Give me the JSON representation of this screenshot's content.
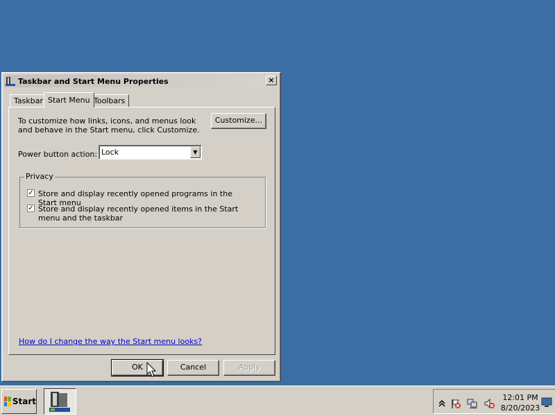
{
  "dialog": {
    "title": "Taskbar and Start Menu Properties",
    "close_label": "×",
    "tabs": [
      {
        "label": "Taskbar",
        "active": false
      },
      {
        "label": "Start Menu",
        "active": true
      },
      {
        "label": "Toolbars",
        "active": false
      }
    ],
    "description": "To customize how links, icons, and menus look and behave in the Start menu, click Customize.",
    "customize_label": "Customize...",
    "power_label": "Power button action:",
    "power_value": "Lock",
    "privacy": {
      "legend": "Privacy",
      "items": [
        {
          "label": "Store and display recently opened programs in the Start menu",
          "checked": true
        },
        {
          "label": "Store and display recently opened items in the Start menu and the taskbar",
          "checked": true
        }
      ]
    },
    "help_link": "How do I change the way the Start menu looks?",
    "buttons": {
      "ok": "OK",
      "cancel": "Cancel",
      "apply": "Apply"
    }
  },
  "taskbar": {
    "start_label": "Start",
    "clock_time": "12:01 PM",
    "clock_date": "8/20/2023",
    "tray_icons": [
      "chevron-up-icon",
      "action-center-flag-icon",
      "network-icon",
      "volume-muted-icon",
      "show-desktop-icon"
    ]
  },
  "colors": {
    "desktop": "#3a6ea5",
    "window_face": "#d4d0c8",
    "link": "#0000cc"
  }
}
